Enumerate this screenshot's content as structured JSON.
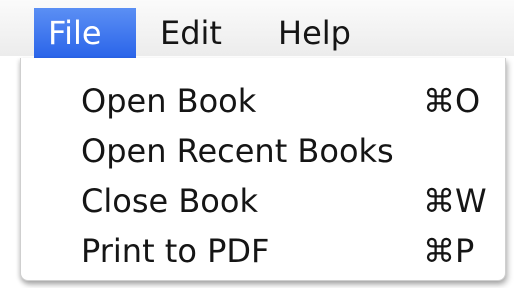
{
  "menubar": {
    "items": [
      {
        "label": "File",
        "active": true
      },
      {
        "label": "Edit",
        "active": false
      },
      {
        "label": "Help",
        "active": false
      }
    ]
  },
  "file_menu": {
    "items": [
      {
        "label": "Open Book",
        "shortcut": "⌘O"
      },
      {
        "label": "Open Recent Books",
        "shortcut": ""
      },
      {
        "label": "Close Book",
        "shortcut": "⌘W"
      },
      {
        "label": "Print to PDF",
        "shortcut": "⌘P"
      }
    ]
  },
  "colors": {
    "highlight": "#2a64e9",
    "menubar_bg": "#efefef",
    "text": "#151515"
  }
}
